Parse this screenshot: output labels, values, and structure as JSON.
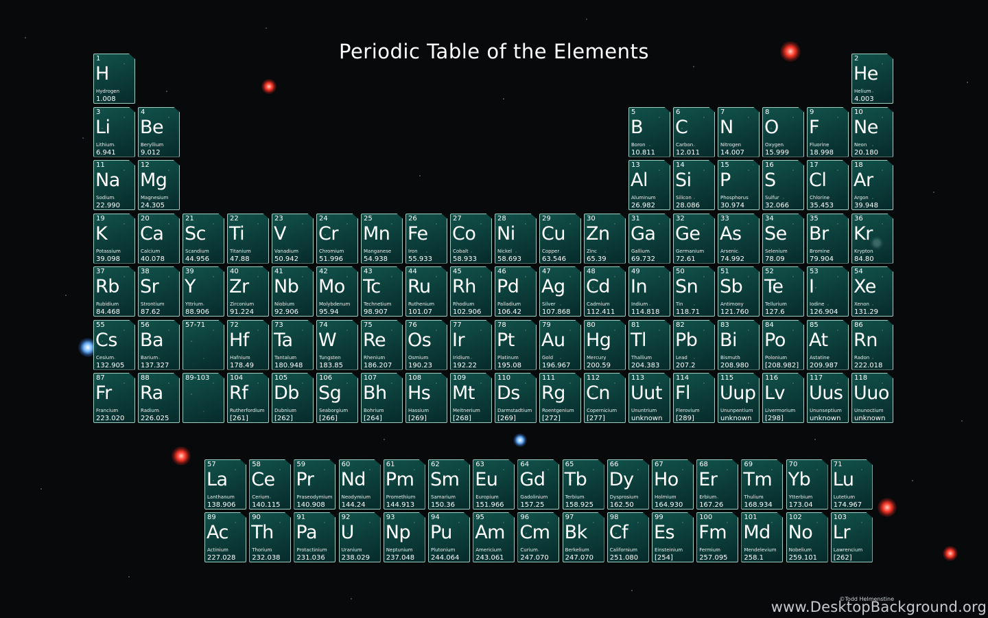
{
  "title": "Periodic Table of the Elements",
  "credit": "©Todd Helmenstine",
  "watermark": "www.DesktopBackground.org",
  "colors": {
    "background": "#07090b",
    "cell_fill": "#0d5a52",
    "cell_border": "#9fcfc2",
    "text": "#ffffff"
  },
  "elements": [
    {
      "num": "1",
      "sym": "H",
      "name": "Hydrogen",
      "mass": "1.008",
      "period": 1,
      "group": 1
    },
    {
      "num": "2",
      "sym": "He",
      "name": "Helium",
      "mass": "4.003",
      "period": 1,
      "group": 18
    },
    {
      "num": "3",
      "sym": "Li",
      "name": "Lithium",
      "mass": "6.941",
      "period": 2,
      "group": 1
    },
    {
      "num": "4",
      "sym": "Be",
      "name": "Beryllium",
      "mass": "9.012",
      "period": 2,
      "group": 2
    },
    {
      "num": "5",
      "sym": "B",
      "name": "Boron",
      "mass": "10.811",
      "period": 2,
      "group": 13
    },
    {
      "num": "6",
      "sym": "C",
      "name": "Carbon",
      "mass": "12.011",
      "period": 2,
      "group": 14
    },
    {
      "num": "7",
      "sym": "N",
      "name": "Nitrogen",
      "mass": "14.007",
      "period": 2,
      "group": 15
    },
    {
      "num": "8",
      "sym": "O",
      "name": "Oxygen",
      "mass": "15.999",
      "period": 2,
      "group": 16
    },
    {
      "num": "9",
      "sym": "F",
      "name": "Fluorine",
      "mass": "18.998",
      "period": 2,
      "group": 17
    },
    {
      "num": "10",
      "sym": "Ne",
      "name": "Neon",
      "mass": "20.180",
      "period": 2,
      "group": 18
    },
    {
      "num": "11",
      "sym": "Na",
      "name": "Sodium",
      "mass": "22.990",
      "period": 3,
      "group": 1
    },
    {
      "num": "12",
      "sym": "Mg",
      "name": "Magnesium",
      "mass": "24.305",
      "period": 3,
      "group": 2
    },
    {
      "num": "13",
      "sym": "Al",
      "name": "Aluminum",
      "mass": "26.982",
      "period": 3,
      "group": 13
    },
    {
      "num": "14",
      "sym": "Si",
      "name": "Silicon",
      "mass": "28.086",
      "period": 3,
      "group": 14
    },
    {
      "num": "15",
      "sym": "P",
      "name": "Phosphorus",
      "mass": "30.974",
      "period": 3,
      "group": 15
    },
    {
      "num": "16",
      "sym": "S",
      "name": "Sulfur",
      "mass": "32.066",
      "period": 3,
      "group": 16
    },
    {
      "num": "17",
      "sym": "Cl",
      "name": "Chlorine",
      "mass": "35.453",
      "period": 3,
      "group": 17
    },
    {
      "num": "18",
      "sym": "Ar",
      "name": "Argon",
      "mass": "39.948",
      "period": 3,
      "group": 18
    },
    {
      "num": "19",
      "sym": "K",
      "name": "Potassium",
      "mass": "39.098",
      "period": 4,
      "group": 1
    },
    {
      "num": "20",
      "sym": "Ca",
      "name": "Calcium",
      "mass": "40.078",
      "period": 4,
      "group": 2
    },
    {
      "num": "21",
      "sym": "Sc",
      "name": "Scandium",
      "mass": "44.956",
      "period": 4,
      "group": 3
    },
    {
      "num": "22",
      "sym": "Ti",
      "name": "Titanium",
      "mass": "47.88",
      "period": 4,
      "group": 4
    },
    {
      "num": "23",
      "sym": "V",
      "name": "Vanadium",
      "mass": "50.942",
      "period": 4,
      "group": 5
    },
    {
      "num": "24",
      "sym": "Cr",
      "name": "Chromium",
      "mass": "51.996",
      "period": 4,
      "group": 6
    },
    {
      "num": "25",
      "sym": "Mn",
      "name": "Manganese",
      "mass": "54.938",
      "period": 4,
      "group": 7
    },
    {
      "num": "26",
      "sym": "Fe",
      "name": "Iron",
      "mass": "55.933",
      "period": 4,
      "group": 8
    },
    {
      "num": "27",
      "sym": "Co",
      "name": "Cobalt",
      "mass": "58.933",
      "period": 4,
      "group": 9
    },
    {
      "num": "28",
      "sym": "Ni",
      "name": "Nickel",
      "mass": "58.693",
      "period": 4,
      "group": 10
    },
    {
      "num": "29",
      "sym": "Cu",
      "name": "Copper",
      "mass": "63.546",
      "period": 4,
      "group": 11
    },
    {
      "num": "30",
      "sym": "Zn",
      "name": "Zinc",
      "mass": "65.39",
      "period": 4,
      "group": 12
    },
    {
      "num": "31",
      "sym": "Ga",
      "name": "Gallium",
      "mass": "69.732",
      "period": 4,
      "group": 13
    },
    {
      "num": "32",
      "sym": "Ge",
      "name": "Germanium",
      "mass": "72.61",
      "period": 4,
      "group": 14
    },
    {
      "num": "33",
      "sym": "As",
      "name": "Arsenic",
      "mass": "74.992",
      "period": 4,
      "group": 15
    },
    {
      "num": "34",
      "sym": "Se",
      "name": "Selenium",
      "mass": "78.09",
      "period": 4,
      "group": 16
    },
    {
      "num": "35",
      "sym": "Br",
      "name": "Bromine",
      "mass": "79.904",
      "period": 4,
      "group": 17
    },
    {
      "num": "36",
      "sym": "Kr",
      "name": "Krypton",
      "mass": "84.80",
      "period": 4,
      "group": 18
    },
    {
      "num": "37",
      "sym": "Rb",
      "name": "Rubidium",
      "mass": "84.468",
      "period": 5,
      "group": 1
    },
    {
      "num": "38",
      "sym": "Sr",
      "name": "Strontium",
      "mass": "87.62",
      "period": 5,
      "group": 2
    },
    {
      "num": "39",
      "sym": "Y",
      "name": "Yttrium",
      "mass": "88.906",
      "period": 5,
      "group": 3
    },
    {
      "num": "40",
      "sym": "Zr",
      "name": "Zirconium",
      "mass": "91.224",
      "period": 5,
      "group": 4
    },
    {
      "num": "41",
      "sym": "Nb",
      "name": "Niobium",
      "mass": "92.906",
      "period": 5,
      "group": 5
    },
    {
      "num": "42",
      "sym": "Mo",
      "name": "Molybdenum",
      "mass": "95.94",
      "period": 5,
      "group": 6
    },
    {
      "num": "43",
      "sym": "Tc",
      "name": "Technetium",
      "mass": "98.907",
      "period": 5,
      "group": 7
    },
    {
      "num": "44",
      "sym": "Ru",
      "name": "Ruthenium",
      "mass": "101.07",
      "period": 5,
      "group": 8
    },
    {
      "num": "45",
      "sym": "Rh",
      "name": "Rhodium",
      "mass": "102.906",
      "period": 5,
      "group": 9
    },
    {
      "num": "46",
      "sym": "Pd",
      "name": "Palladium",
      "mass": "106.42",
      "period": 5,
      "group": 10
    },
    {
      "num": "47",
      "sym": "Ag",
      "name": "Silver",
      "mass": "107.868",
      "period": 5,
      "group": 11
    },
    {
      "num": "48",
      "sym": "Cd",
      "name": "Cadmium",
      "mass": "112.411",
      "period": 5,
      "group": 12
    },
    {
      "num": "49",
      "sym": "In",
      "name": "Indium",
      "mass": "114.818",
      "period": 5,
      "group": 13
    },
    {
      "num": "50",
      "sym": "Sn",
      "name": "Tin",
      "mass": "118.71",
      "period": 5,
      "group": 14
    },
    {
      "num": "51",
      "sym": "Sb",
      "name": "Antimony",
      "mass": "121.760",
      "period": 5,
      "group": 15
    },
    {
      "num": "52",
      "sym": "Te",
      "name": "Tellurium",
      "mass": "127.6",
      "period": 5,
      "group": 16
    },
    {
      "num": "53",
      "sym": "I",
      "name": "Iodine",
      "mass": "126.904",
      "period": 5,
      "group": 17
    },
    {
      "num": "54",
      "sym": "Xe",
      "name": "Xenon",
      "mass": "131.29",
      "period": 5,
      "group": 18
    },
    {
      "num": "55",
      "sym": "Cs",
      "name": "Cesium",
      "mass": "132.905",
      "period": 6,
      "group": 1
    },
    {
      "num": "56",
      "sym": "Ba",
      "name": "Barium",
      "mass": "137.327",
      "period": 6,
      "group": 2
    },
    {
      "num": "57-71",
      "sym": "",
      "name": "",
      "mass": "",
      "period": 6,
      "group": 3
    },
    {
      "num": "72",
      "sym": "Hf",
      "name": "Hafnium",
      "mass": "178.49",
      "period": 6,
      "group": 4
    },
    {
      "num": "73",
      "sym": "Ta",
      "name": "Tantalum",
      "mass": "180.948",
      "period": 6,
      "group": 5
    },
    {
      "num": "74",
      "sym": "W",
      "name": "Tungsten",
      "mass": "183.85",
      "period": 6,
      "group": 6
    },
    {
      "num": "75",
      "sym": "Re",
      "name": "Rhenium",
      "mass": "186.207",
      "period": 6,
      "group": 7
    },
    {
      "num": "76",
      "sym": "Os",
      "name": "Osmium",
      "mass": "190.23",
      "period": 6,
      "group": 8
    },
    {
      "num": "77",
      "sym": "Ir",
      "name": "Iridium",
      "mass": "192.22",
      "period": 6,
      "group": 9
    },
    {
      "num": "78",
      "sym": "Pt",
      "name": "Platinum",
      "mass": "195.08",
      "period": 6,
      "group": 10
    },
    {
      "num": "79",
      "sym": "Au",
      "name": "Gold",
      "mass": "196.967",
      "period": 6,
      "group": 11
    },
    {
      "num": "80",
      "sym": "Hg",
      "name": "Mercury",
      "mass": "200.59",
      "period": 6,
      "group": 12
    },
    {
      "num": "81",
      "sym": "Tl",
      "name": "Thallium",
      "mass": "204.383",
      "period": 6,
      "group": 13
    },
    {
      "num": "82",
      "sym": "Pb",
      "name": "Lead",
      "mass": "207.2",
      "period": 6,
      "group": 14
    },
    {
      "num": "83",
      "sym": "Bi",
      "name": "Bismuth",
      "mass": "208.980",
      "period": 6,
      "group": 15
    },
    {
      "num": "84",
      "sym": "Po",
      "name": "Polonium",
      "mass": "[208.982]",
      "period": 6,
      "group": 16
    },
    {
      "num": "85",
      "sym": "At",
      "name": "Astatine",
      "mass": "209.987",
      "period": 6,
      "group": 17
    },
    {
      "num": "86",
      "sym": "Rn",
      "name": "Radon",
      "mass": "222.018",
      "period": 6,
      "group": 18
    },
    {
      "num": "87",
      "sym": "Fr",
      "name": "Francium",
      "mass": "223.020",
      "period": 7,
      "group": 1
    },
    {
      "num": "88",
      "sym": "Ra",
      "name": "Radium",
      "mass": "226.025",
      "period": 7,
      "group": 2
    },
    {
      "num": "89-103",
      "sym": "",
      "name": "",
      "mass": "",
      "period": 7,
      "group": 3
    },
    {
      "num": "104",
      "sym": "Rf",
      "name": "Rutherfordium",
      "mass": "[261]",
      "period": 7,
      "group": 4
    },
    {
      "num": "105",
      "sym": "Db",
      "name": "Dubnium",
      "mass": "[262]",
      "period": 7,
      "group": 5
    },
    {
      "num": "106",
      "sym": "Sg",
      "name": "Seaborgium",
      "mass": "[266]",
      "period": 7,
      "group": 6
    },
    {
      "num": "107",
      "sym": "Bh",
      "name": "Bohrium",
      "mass": "[264]",
      "period": 7,
      "group": 7
    },
    {
      "num": "108",
      "sym": "Hs",
      "name": "Hassium",
      "mass": "[269]",
      "period": 7,
      "group": 8
    },
    {
      "num": "109",
      "sym": "Mt",
      "name": "Meitnerium",
      "mass": "[268]",
      "period": 7,
      "group": 9
    },
    {
      "num": "110",
      "sym": "Ds",
      "name": "Darmstadtium",
      "mass": "[269]",
      "period": 7,
      "group": 10
    },
    {
      "num": "111",
      "sym": "Rg",
      "name": "Roentgenium",
      "mass": "[272]",
      "period": 7,
      "group": 11
    },
    {
      "num": "112",
      "sym": "Cn",
      "name": "Copernicium",
      "mass": "[277]",
      "period": 7,
      "group": 12
    },
    {
      "num": "113",
      "sym": "Uut",
      "name": "Ununtrium",
      "mass": "unknown",
      "period": 7,
      "group": 13
    },
    {
      "num": "114",
      "sym": "Fl",
      "name": "Flerovium",
      "mass": "[289]",
      "period": 7,
      "group": 14
    },
    {
      "num": "115",
      "sym": "Uup",
      "name": "Ununpentium",
      "mass": "unknown",
      "period": 7,
      "group": 15
    },
    {
      "num": "116",
      "sym": "Lv",
      "name": "Livermorium",
      "mass": "[298]",
      "period": 7,
      "group": 16
    },
    {
      "num": "117",
      "sym": "Uus",
      "name": "Ununseptium",
      "mass": "unknown",
      "period": 7,
      "group": 17
    },
    {
      "num": "118",
      "sym": "Uuo",
      "name": "Ununoctium",
      "mass": "unknown",
      "period": 7,
      "group": 18
    }
  ],
  "lanthanides": [
    {
      "num": "57",
      "sym": "La",
      "name": "Lanthanum",
      "mass": "138.906"
    },
    {
      "num": "58",
      "sym": "Ce",
      "name": "Cerium",
      "mass": "140.115"
    },
    {
      "num": "59",
      "sym": "Pr",
      "name": "Praseodymium",
      "mass": "140.908"
    },
    {
      "num": "60",
      "sym": "Nd",
      "name": "Neodymium",
      "mass": "144.24"
    },
    {
      "num": "61",
      "sym": "Pm",
      "name": "Promethium",
      "mass": "144.913"
    },
    {
      "num": "62",
      "sym": "Sm",
      "name": "Samarium",
      "mass": "150.36"
    },
    {
      "num": "63",
      "sym": "Eu",
      "name": "Europium",
      "mass": "151.966"
    },
    {
      "num": "64",
      "sym": "Gd",
      "name": "Gadolinium",
      "mass": "157.25"
    },
    {
      "num": "65",
      "sym": "Tb",
      "name": "Terbium",
      "mass": "158.925"
    },
    {
      "num": "66",
      "sym": "Dy",
      "name": "Dysprosium",
      "mass": "162.50"
    },
    {
      "num": "67",
      "sym": "Ho",
      "name": "Holmium",
      "mass": "164.930"
    },
    {
      "num": "68",
      "sym": "Er",
      "name": "Erbium",
      "mass": "167.26"
    },
    {
      "num": "69",
      "sym": "Tm",
      "name": "Thulium",
      "mass": "168.934"
    },
    {
      "num": "70",
      "sym": "Yb",
      "name": "Ytterbium",
      "mass": "173.04"
    },
    {
      "num": "71",
      "sym": "Lu",
      "name": "Lutetium",
      "mass": "174.967"
    }
  ],
  "actinides": [
    {
      "num": "89",
      "sym": "Ac",
      "name": "Actinium",
      "mass": "227.028"
    },
    {
      "num": "90",
      "sym": "Th",
      "name": "Thorium",
      "mass": "232.038"
    },
    {
      "num": "91",
      "sym": "Pa",
      "name": "Protactinium",
      "mass": "231.036"
    },
    {
      "num": "92",
      "sym": "U",
      "name": "Uranium",
      "mass": "238.029"
    },
    {
      "num": "93",
      "sym": "Np",
      "name": "Neptunium",
      "mass": "237.048"
    },
    {
      "num": "94",
      "sym": "Pu",
      "name": "Plutonium",
      "mass": "244.064"
    },
    {
      "num": "95",
      "sym": "Am",
      "name": "Americium",
      "mass": "243.061"
    },
    {
      "num": "96",
      "sym": "Cm",
      "name": "Curium",
      "mass": "247.070"
    },
    {
      "num": "97",
      "sym": "Bk",
      "name": "Berkelium",
      "mass": "247.070"
    },
    {
      "num": "98",
      "sym": "Cf",
      "name": "Californium",
      "mass": "251.080"
    },
    {
      "num": "99",
      "sym": "Es",
      "name": "Einsteinium",
      "mass": "[254]"
    },
    {
      "num": "100",
      "sym": "Fm",
      "name": "Fermium",
      "mass": "257.095"
    },
    {
      "num": "101",
      "sym": "Md",
      "name": "Mendelevium",
      "mass": "258.1"
    },
    {
      "num": "102",
      "sym": "No",
      "name": "Nobelium",
      "mass": "259.101"
    },
    {
      "num": "103",
      "sym": "Lr",
      "name": "Lawrencium",
      "mass": "[262]"
    }
  ]
}
